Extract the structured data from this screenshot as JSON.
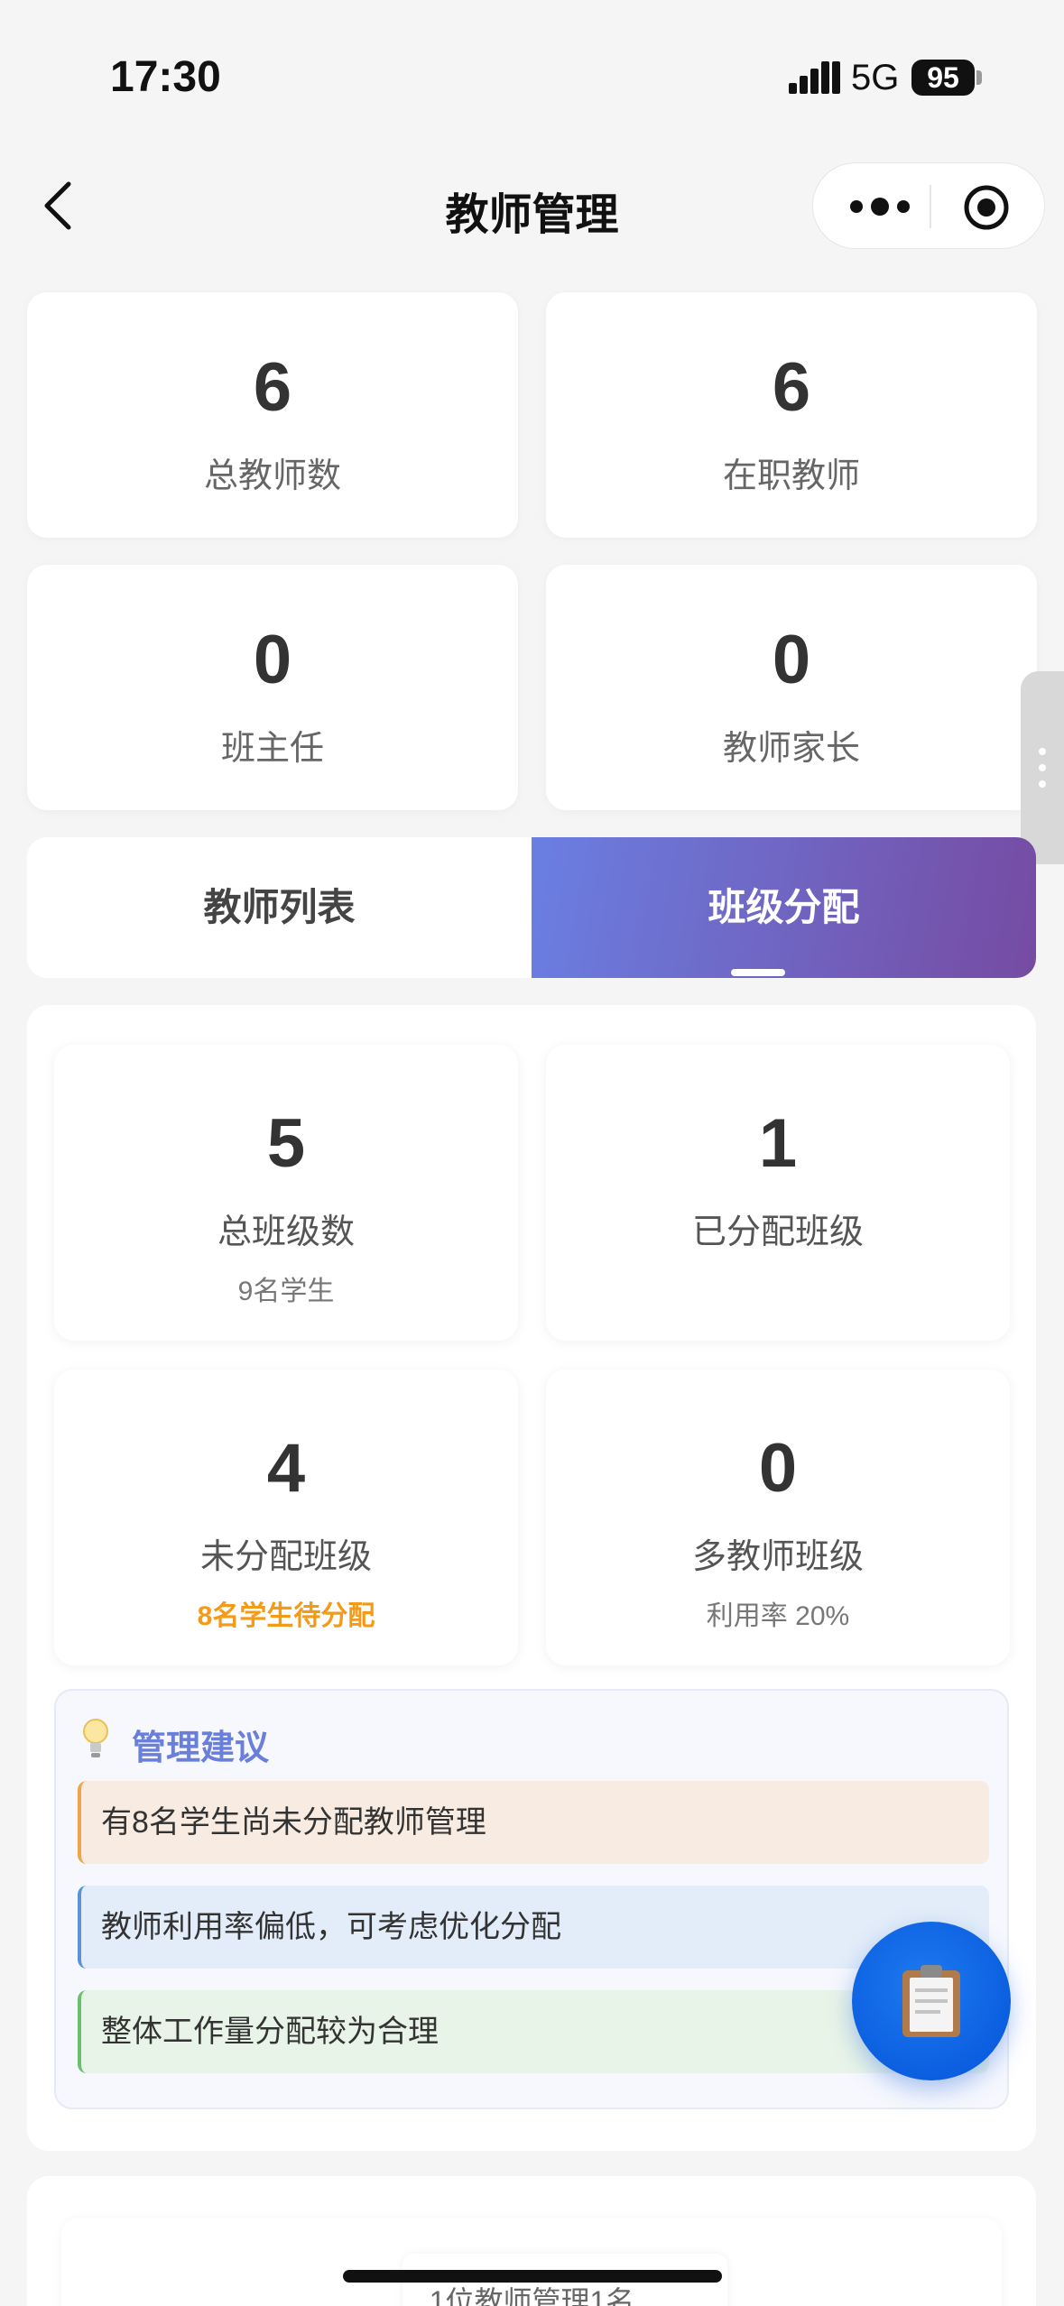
{
  "status_bar": {
    "time": "17:30",
    "network": "5G",
    "battery": "95"
  },
  "nav": {
    "title": "教师管理"
  },
  "stats": [
    {
      "value": "6",
      "label": "总教师数"
    },
    {
      "value": "6",
      "label": "在职教师"
    },
    {
      "value": "0",
      "label": "班主任"
    },
    {
      "value": "0",
      "label": "教师家长"
    }
  ],
  "tabs": {
    "list": "教师列表",
    "assign": "班级分配",
    "active": "班级分配"
  },
  "class_stats": [
    {
      "value": "5",
      "label": "总班级数",
      "sub": "9名学生"
    },
    {
      "value": "1",
      "label": "已分配班级",
      "sub": ""
    },
    {
      "value": "4",
      "label": "未分配班级",
      "sub": "8名学生待分配"
    },
    {
      "value": "0",
      "label": "多教师班级",
      "sub": "利用率 20%"
    }
  ],
  "advice": {
    "title": "管理建议",
    "tips": [
      "有8名学生尚未分配教师管理",
      "教师利用率偏低，可考虑优化分配",
      "整体工作量分配较为合理"
    ]
  },
  "bottom": {
    "text": "1位教师管理1名"
  },
  "colors": {
    "accent_start": "#6a7fe2",
    "accent_end": "#764ba2",
    "warn": "#f39a16",
    "fab": "#0b5fe0"
  },
  "icons": {
    "fab": "clipboard-icon",
    "advice": "lightbulb-icon"
  }
}
